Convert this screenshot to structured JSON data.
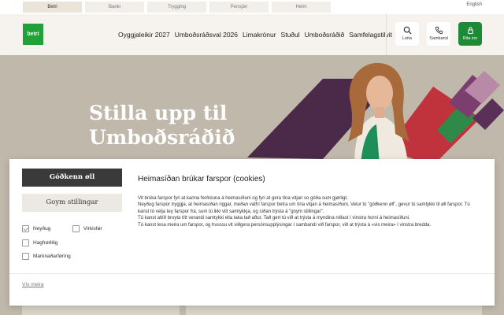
{
  "top_tabs": [
    "Betri",
    "Banki",
    "Trygging",
    "Pensjón",
    "Heim"
  ],
  "language": "English",
  "logo_text": "betri",
  "main_nav": [
    "Oyggjaleikir 2027",
    "Umboðsráðsval 2026",
    "Limakrónur",
    "Stuðul",
    "Umboðsráðið",
    "Samfelagstilvit"
  ],
  "header_buttons": {
    "search": "Leita",
    "call": "Samband",
    "login": "Rita inn"
  },
  "hero": {
    "title_line1": "Stilla upp til",
    "title_line2": "Umboðsráðið"
  },
  "cookie": {
    "approve_all": "Góðkenn øll",
    "save_settings": "Goym stillingar",
    "categories": [
      {
        "label": "Neyðug",
        "checked": true
      },
      {
        "label": "Virkisfør",
        "checked": false
      },
      {
        "label": "Hagfrøðilig",
        "checked": false
      },
      {
        "label": "Marknaðarføring",
        "checked": false
      }
    ],
    "title": "Heimasíðan brúkar farspor (cookies)",
    "paragraphs": [
      "Vit brúka farspor fyri at kanna ferðsluna á heimasíðuni og fyri at gera tína vitjan so góða sum gjørligt.",
      "Neyðug farspor tryggja, at heimasíðan riggar, meðan valfrí farspor betra um tína vitjan á heimasíðuni. Velur tú \"góðkenn øll\", gevur tú samtykki til øll farspor. Tú kanst tó velja tey farspor frá, sum tú ikki vilt samtykkja, og síðan trýsta á \"goym stillingar\".",
      "Tú kanst altíð broyta títt verandi samtykki ella taka tað aftur. Tað gert tú við at trýsta á myndina niðast í vinstra horni á heimasíðuni.",
      "Tú kanst lesa meira um farspor, og hvussu vit viðgera persónsupplýsingar í sambandi við farspor, við at trýsta á «vis meira» í vinstra bredda."
    ],
    "more_link": "Vís meira"
  },
  "colors": {
    "brand_green": "#22a03a",
    "login_green": "#1d8a36",
    "hero_bg": "#c0b9ab",
    "shape_purple": "#4a2a48",
    "shape_red": "#c0333d",
    "dark_button": "#3a3a3a"
  }
}
